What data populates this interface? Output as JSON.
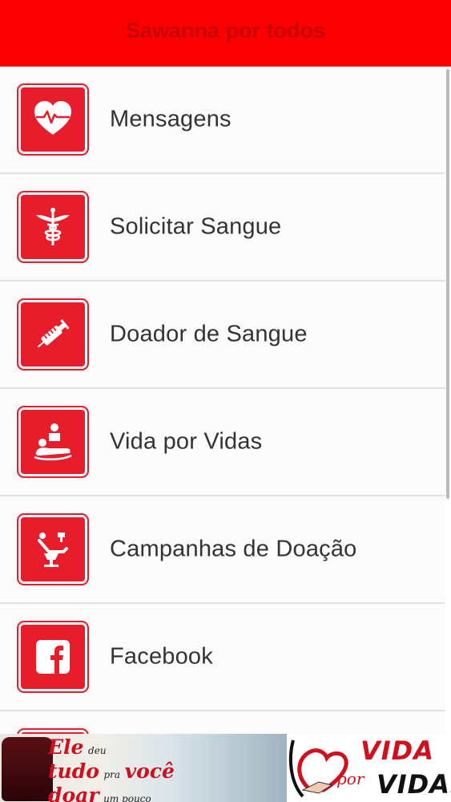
{
  "header": {
    "title": "Sawanna por todos"
  },
  "menu": {
    "items": [
      {
        "label": "Mensagens",
        "icon": "heart-pulse-icon"
      },
      {
        "label": "Solicitar Sangue",
        "icon": "caduceus-icon"
      },
      {
        "label": "Doador de Sangue",
        "icon": "syringe-icon"
      },
      {
        "label": "Vida por Vidas",
        "icon": "donor-patient-icon"
      },
      {
        "label": "Campanhas de Doação",
        "icon": "donation-chair-icon"
      },
      {
        "label": "Facebook",
        "icon": "facebook-icon"
      },
      {
        "label": "",
        "icon": "partial-tile-icon"
      }
    ]
  },
  "banner": {
    "slogan": {
      "w1": "Ele",
      "w2": "deu",
      "w3": "tudo",
      "w4": "pra",
      "w5": "você",
      "w6": "doar",
      "w7": "um pouco"
    },
    "logo": {
      "vida": "VIDA",
      "por": "por",
      "vidas": "VIDAS"
    }
  },
  "colors": {
    "header": "#fb0000",
    "tile": "#e71d2c",
    "label": "#333333"
  }
}
